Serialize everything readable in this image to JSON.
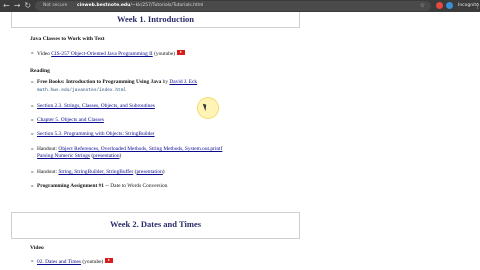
{
  "browser": {
    "nav_icons": [
      "←",
      "→",
      "↻"
    ],
    "secure_label": "Not secure",
    "url_domain": "cinweb.bestnote.edu",
    "url_path": "/~kk/257/Tutorials/Tutorials.html",
    "profile_label": "Incognito",
    "extension_colors": [
      "#e64a3c",
      "#3a8fd9"
    ]
  },
  "week1": {
    "title": "Week 1. Introduction",
    "java_heading": "Java Classes to Work with Text",
    "video_prefix": "Video",
    "video_link": "CIS-257 Object-Oriented Java Programming II",
    "video_suffix": "(youtube)",
    "reading_heading": "Reading",
    "free_books": "Free Books: Introduction to Programming Using Java",
    "by": "by",
    "author": "David J. Eck",
    "book_url": "math.hws.edu/javanotes/index.html",
    "section23": "Section 2.3. Strings, Classes, Objects, and Subroutines",
    "chapter5": "Chapter 5. Objects and Classes",
    "section53": "Section 5.3. Programming with Objects: StringBuilder",
    "handout1_prefix": "Handout:",
    "handout1_link": "Object References, Overloaded Methods, String Methods, System.out.printf",
    "handout1_line2": "Parsing Numeric Strings",
    "presentation": "presentation",
    "handout2_prefix": "Handout:",
    "handout2_link": "String, StringBuilder, StringBuffer",
    "assignment_bold": "Programming Assignment #1",
    "assignment_rest": "-- Date to Words Conversion"
  },
  "week2": {
    "title": "Week 2. Dates and Times",
    "video_heading": "Video",
    "video_link": "02. Dates and Times",
    "video_suffix": "(youtube)"
  }
}
